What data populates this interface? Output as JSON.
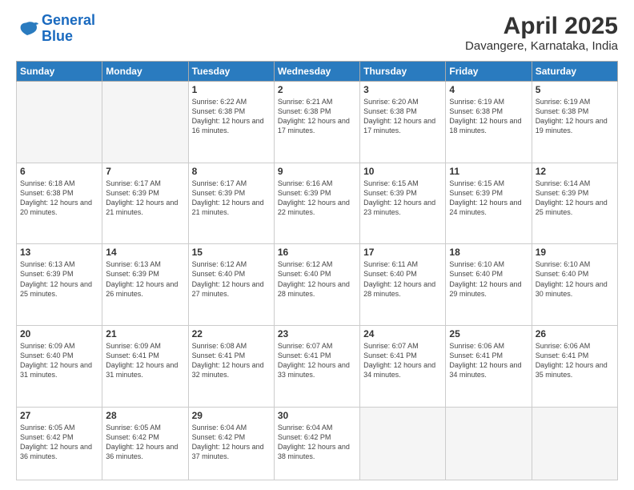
{
  "logo": {
    "line1": "General",
    "line2": "Blue"
  },
  "title": "April 2025",
  "subtitle": "Davangere, Karnataka, India",
  "days_header": [
    "Sunday",
    "Monday",
    "Tuesday",
    "Wednesday",
    "Thursday",
    "Friday",
    "Saturday"
  ],
  "weeks": [
    [
      {
        "day": "",
        "info": ""
      },
      {
        "day": "",
        "info": ""
      },
      {
        "day": "1",
        "info": "Sunrise: 6:22 AM\nSunset: 6:38 PM\nDaylight: 12 hours and 16 minutes."
      },
      {
        "day": "2",
        "info": "Sunrise: 6:21 AM\nSunset: 6:38 PM\nDaylight: 12 hours and 17 minutes."
      },
      {
        "day": "3",
        "info": "Sunrise: 6:20 AM\nSunset: 6:38 PM\nDaylight: 12 hours and 17 minutes."
      },
      {
        "day": "4",
        "info": "Sunrise: 6:19 AM\nSunset: 6:38 PM\nDaylight: 12 hours and 18 minutes."
      },
      {
        "day": "5",
        "info": "Sunrise: 6:19 AM\nSunset: 6:38 PM\nDaylight: 12 hours and 19 minutes."
      }
    ],
    [
      {
        "day": "6",
        "info": "Sunrise: 6:18 AM\nSunset: 6:38 PM\nDaylight: 12 hours and 20 minutes."
      },
      {
        "day": "7",
        "info": "Sunrise: 6:17 AM\nSunset: 6:39 PM\nDaylight: 12 hours and 21 minutes."
      },
      {
        "day": "8",
        "info": "Sunrise: 6:17 AM\nSunset: 6:39 PM\nDaylight: 12 hours and 21 minutes."
      },
      {
        "day": "9",
        "info": "Sunrise: 6:16 AM\nSunset: 6:39 PM\nDaylight: 12 hours and 22 minutes."
      },
      {
        "day": "10",
        "info": "Sunrise: 6:15 AM\nSunset: 6:39 PM\nDaylight: 12 hours and 23 minutes."
      },
      {
        "day": "11",
        "info": "Sunrise: 6:15 AM\nSunset: 6:39 PM\nDaylight: 12 hours and 24 minutes."
      },
      {
        "day": "12",
        "info": "Sunrise: 6:14 AM\nSunset: 6:39 PM\nDaylight: 12 hours and 25 minutes."
      }
    ],
    [
      {
        "day": "13",
        "info": "Sunrise: 6:13 AM\nSunset: 6:39 PM\nDaylight: 12 hours and 25 minutes."
      },
      {
        "day": "14",
        "info": "Sunrise: 6:13 AM\nSunset: 6:39 PM\nDaylight: 12 hours and 26 minutes."
      },
      {
        "day": "15",
        "info": "Sunrise: 6:12 AM\nSunset: 6:40 PM\nDaylight: 12 hours and 27 minutes."
      },
      {
        "day": "16",
        "info": "Sunrise: 6:12 AM\nSunset: 6:40 PM\nDaylight: 12 hours and 28 minutes."
      },
      {
        "day": "17",
        "info": "Sunrise: 6:11 AM\nSunset: 6:40 PM\nDaylight: 12 hours and 28 minutes."
      },
      {
        "day": "18",
        "info": "Sunrise: 6:10 AM\nSunset: 6:40 PM\nDaylight: 12 hours and 29 minutes."
      },
      {
        "day": "19",
        "info": "Sunrise: 6:10 AM\nSunset: 6:40 PM\nDaylight: 12 hours and 30 minutes."
      }
    ],
    [
      {
        "day": "20",
        "info": "Sunrise: 6:09 AM\nSunset: 6:40 PM\nDaylight: 12 hours and 31 minutes."
      },
      {
        "day": "21",
        "info": "Sunrise: 6:09 AM\nSunset: 6:41 PM\nDaylight: 12 hours and 31 minutes."
      },
      {
        "day": "22",
        "info": "Sunrise: 6:08 AM\nSunset: 6:41 PM\nDaylight: 12 hours and 32 minutes."
      },
      {
        "day": "23",
        "info": "Sunrise: 6:07 AM\nSunset: 6:41 PM\nDaylight: 12 hours and 33 minutes."
      },
      {
        "day": "24",
        "info": "Sunrise: 6:07 AM\nSunset: 6:41 PM\nDaylight: 12 hours and 34 minutes."
      },
      {
        "day": "25",
        "info": "Sunrise: 6:06 AM\nSunset: 6:41 PM\nDaylight: 12 hours and 34 minutes."
      },
      {
        "day": "26",
        "info": "Sunrise: 6:06 AM\nSunset: 6:41 PM\nDaylight: 12 hours and 35 minutes."
      }
    ],
    [
      {
        "day": "27",
        "info": "Sunrise: 6:05 AM\nSunset: 6:42 PM\nDaylight: 12 hours and 36 minutes."
      },
      {
        "day": "28",
        "info": "Sunrise: 6:05 AM\nSunset: 6:42 PM\nDaylight: 12 hours and 36 minutes."
      },
      {
        "day": "29",
        "info": "Sunrise: 6:04 AM\nSunset: 6:42 PM\nDaylight: 12 hours and 37 minutes."
      },
      {
        "day": "30",
        "info": "Sunrise: 6:04 AM\nSunset: 6:42 PM\nDaylight: 12 hours and 38 minutes."
      },
      {
        "day": "",
        "info": ""
      },
      {
        "day": "",
        "info": ""
      },
      {
        "day": "",
        "info": ""
      }
    ]
  ]
}
